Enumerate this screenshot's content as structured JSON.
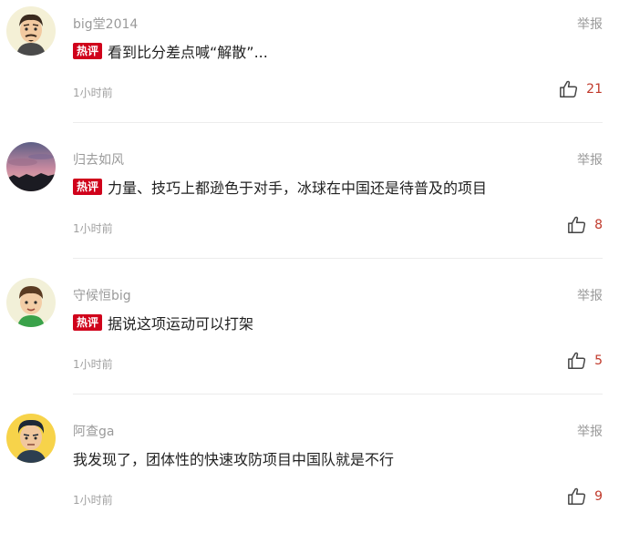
{
  "comments": [
    {
      "username": "big堂2014",
      "report_label": "举报",
      "hot_badge": "热评",
      "text": "看到比分差点喊“解散”...",
      "time": "1小时前",
      "likes": "21"
    },
    {
      "username": "归去如风",
      "report_label": "举报",
      "hot_badge": "热评",
      "text": "力量、技巧上都逊色于对手，冰球在中国还是待普及的项目",
      "time": "1小时前",
      "likes": "8"
    },
    {
      "username": "守候恒big",
      "report_label": "举报",
      "hot_badge": "热评",
      "text": "据说这项运动可以打架",
      "time": "1小时前",
      "likes": "5"
    },
    {
      "username": "阿查ga",
      "report_label": "举报",
      "text": "我发现了，团体性的快速攻防项目中国队就是不行",
      "time": "1小时前",
      "likes": "9"
    }
  ],
  "colors": {
    "hot_badge_bg": "#d0021b",
    "like_count": "#c0392b",
    "meta_text": "#9a9a9a"
  }
}
